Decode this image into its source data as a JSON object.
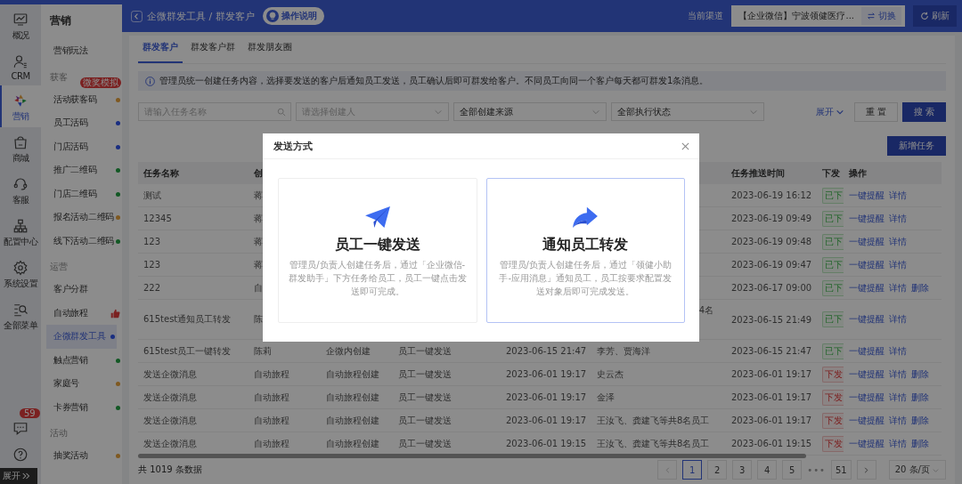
{
  "rail": {
    "items": [
      {
        "label": "概况",
        "selected": false
      },
      {
        "label": "CRM",
        "selected": false
      },
      {
        "label": "营销",
        "selected": true
      },
      {
        "label": "商城",
        "selected": false
      },
      {
        "label": "客服",
        "selected": false
      },
      {
        "label": "配置中心",
        "selected": false
      },
      {
        "label": "系统设置",
        "selected": false
      },
      {
        "label": "全部菜单",
        "selected": false
      }
    ],
    "message_badge": "59",
    "expand_label": "展开"
  },
  "submenu": {
    "title": "营销",
    "groups": [
      {
        "items": [
          {
            "label": "营销玩法",
            "kind": "plain",
            "selected": false
          }
        ]
      },
      {
        "heading": "获客",
        "items": [
          {
            "label": "活动获客码",
            "kind": "dot",
            "color": "#7f5921",
            "selected": false,
            "tag": "微奖模拟"
          },
          {
            "label": "员工活码",
            "kind": "dot",
            "color": "#1a2e81",
            "selected": false
          },
          {
            "label": "门店活码",
            "kind": "dot",
            "color": "#1a2e81",
            "selected": false
          },
          {
            "label": "推广二维码",
            "kind": "dot",
            "color": "#125824",
            "selected": false
          },
          {
            "label": "门店二维码",
            "kind": "dot",
            "color": "#125824",
            "selected": false
          },
          {
            "label": "报名活动二维码",
            "kind": "dot",
            "color": "#7f5921",
            "selected": false
          },
          {
            "label": "线下活动二维码",
            "kind": "dot",
            "color": "#125824",
            "selected": false
          }
        ]
      },
      {
        "heading": "运营",
        "items": [
          {
            "label": "客户分群",
            "kind": "plain",
            "selected": false
          },
          {
            "label": "自动旅程",
            "kind": "like",
            "selected": false
          },
          {
            "label": "企微群发工具",
            "kind": "dot",
            "color": "#1a2e81",
            "selected": true
          },
          {
            "label": "触点营销",
            "kind": "dot",
            "color": "#125824",
            "selected": false
          },
          {
            "label": "家庭号",
            "kind": "dot",
            "color": "#7f5921",
            "selected": false
          },
          {
            "label": "卡券营销",
            "kind": "dot",
            "color": "#125824",
            "selected": false
          }
        ]
      },
      {
        "heading": "活动",
        "items": [
          {
            "label": "抽奖活动",
            "kind": "dot",
            "color": "#7f5921",
            "selected": false
          }
        ]
      }
    ]
  },
  "header": {
    "breadcrumb": "企微群发工具 / 群发客户",
    "guide_button": "操作说明",
    "channel_label": "当前渠道",
    "channel_value": "【企业微信】宁波领健医疗...",
    "switch_button": "切换",
    "refresh_button": "刷新"
  },
  "tabs": [
    {
      "label": "群发客户",
      "selected": true
    },
    {
      "label": "群发客户群",
      "selected": false
    },
    {
      "label": "群发朋友圈",
      "selected": false
    }
  ],
  "notice": "管理员统一创建任务内容，选择要发送的客户后通知员工发送，员工确认后即可群发给客户。不同员工向同一个客户每天都可群发1条消息。",
  "filters": {
    "task_name": {
      "placeholder": "请输入任务名称"
    },
    "creator": {
      "placeholder": "请选择创建人"
    },
    "source": {
      "value": "全部创建来源"
    },
    "status": {
      "value": "全部执行状态"
    },
    "expand_link": "展开",
    "reset_button": "重 置",
    "search_button": "搜 索"
  },
  "new_task_button": "新增任务",
  "table": {
    "columns": {
      "name": "任务名称",
      "creator": "创",
      "pushed": "任务推送时间",
      "status": "下发",
      "actions": "操作"
    },
    "rows": [
      {
        "name": "测试",
        "wrapped": false,
        "creator": "蒋",
        "pushed": "2023-06-19 16:12",
        "status": {
          "text": "已下",
          "kind": "done"
        },
        "actions": [
          "一键提醒",
          "详情"
        ]
      },
      {
        "name": "12345",
        "wrapped": false,
        "creator": "蒋",
        "pushed": "2023-06-19 09:49",
        "status": {
          "text": "已下",
          "kind": "done"
        },
        "actions": [
          "一键提醒",
          "详情"
        ]
      },
      {
        "name": "123",
        "wrapped": false,
        "creator": "蒋",
        "pushed": "2023-06-19 09:48",
        "status": {
          "text": "已下",
          "kind": "done"
        },
        "actions": [
          "一键提醒",
          "详情"
        ]
      },
      {
        "name": "123",
        "wrapped": false,
        "creator": "蒋",
        "pushed": "2023-06-19 09:47",
        "status": {
          "text": "已下",
          "kind": "done"
        },
        "actions": [
          "一键提醒",
          "详情"
        ]
      },
      {
        "name": "222",
        "wrapped": false,
        "creator": "自",
        "pushed": "2023-06-17 09:00",
        "status": {
          "text": "已下",
          "kind": "done"
        },
        "actions": [
          "一键提醒",
          "详情",
          "删除"
        ]
      },
      {
        "name": "615test通知员工转发",
        "wrapped": true,
        "creator": "陈",
        "staff": "4名",
        "pushed": "2023-06-15 21:49",
        "status": {
          "text": "已下",
          "kind": "done"
        },
        "actions": [
          "一键提醒",
          "详情"
        ]
      },
      {
        "name": "615test员工一键转发",
        "wrapped": false,
        "creator": "陈莉",
        "source": "企微内创建",
        "mode": "员工一键发送",
        "created": "2023-06-15 21:47",
        "staff": "李芳、贾海洋",
        "pushed": "2023-06-15 21:47",
        "status": {
          "text": "已下",
          "kind": "done"
        },
        "actions": [
          "一键提醒",
          "详情"
        ]
      },
      {
        "name": "发送企微消息",
        "creator": "自动旅程",
        "source": "自动旅程创建",
        "mode": "员工一键发送",
        "created": "2023-06-01 19:17",
        "staff": "史云杰",
        "wrapped": false,
        "pushed": "2023-06-01 19:17",
        "status": {
          "text": "下发",
          "kind": "failed"
        },
        "actions": [
          "一键提醒",
          "详情",
          "删除"
        ]
      },
      {
        "name": "发送企微消息",
        "creator": "自动旅程",
        "source": "自动旅程创建",
        "mode": "员工一键发送",
        "created": "2023-06-01 19:17",
        "staff": "金泽",
        "wrapped": false,
        "pushed": "2023-06-01 19:17",
        "status": {
          "text": "下发",
          "kind": "failed"
        },
        "actions": [
          "一键提醒",
          "详情",
          "删除"
        ]
      },
      {
        "name": "发送企微消息",
        "wrapped": false,
        "creator": "自动旅程",
        "source": "自动旅程创建",
        "mode": "员工一键发送",
        "created": "2023-06-01 19:17",
        "staff": "王汝飞、龚建飞等共8名员工",
        "pushed": "2023-06-01 19:17",
        "status": {
          "text": "下发",
          "kind": "failed"
        },
        "actions": [
          "一键提醒",
          "详情",
          "删除"
        ]
      },
      {
        "name": "发送企微消息",
        "wrapped": false,
        "creator": "自动旅程",
        "source": "自动旅程创建",
        "mode": "员工一键发送",
        "created": "2023-06-01 19:15",
        "staff": "王汝飞、龚建飞等共8名员工",
        "pushed": "2023-06-01 19:15",
        "status": {
          "text": "下发",
          "kind": "failed"
        },
        "actions": [
          "一键提醒",
          "详情",
          "删除"
        ]
      }
    ]
  },
  "footer": {
    "total": "共 1019 条数据",
    "pages": [
      {
        "label": "1",
        "selected": true
      },
      {
        "label": "2",
        "selected": false
      },
      {
        "label": "3",
        "selected": false
      },
      {
        "label": "4",
        "selected": false
      },
      {
        "label": "5",
        "selected": false
      }
    ],
    "ellipsis": "•••",
    "last_page": "51",
    "page_size": "20 条/页"
  },
  "dialog": {
    "title": "发送方式",
    "options": [
      {
        "title": "员工一键发送",
        "description": "管理员/负责人创建任务后，通过「企业微信-群发助手」下方任务给员工，员工一键点击发送即可完成。",
        "selected": false
      },
      {
        "title": "通知员工转发",
        "description": "管理员/负责人创建任务后，通过「领健小助手-应用消息」通知员工，员工按要求配置发送对象后即可完成发送。",
        "selected": true
      }
    ]
  }
}
